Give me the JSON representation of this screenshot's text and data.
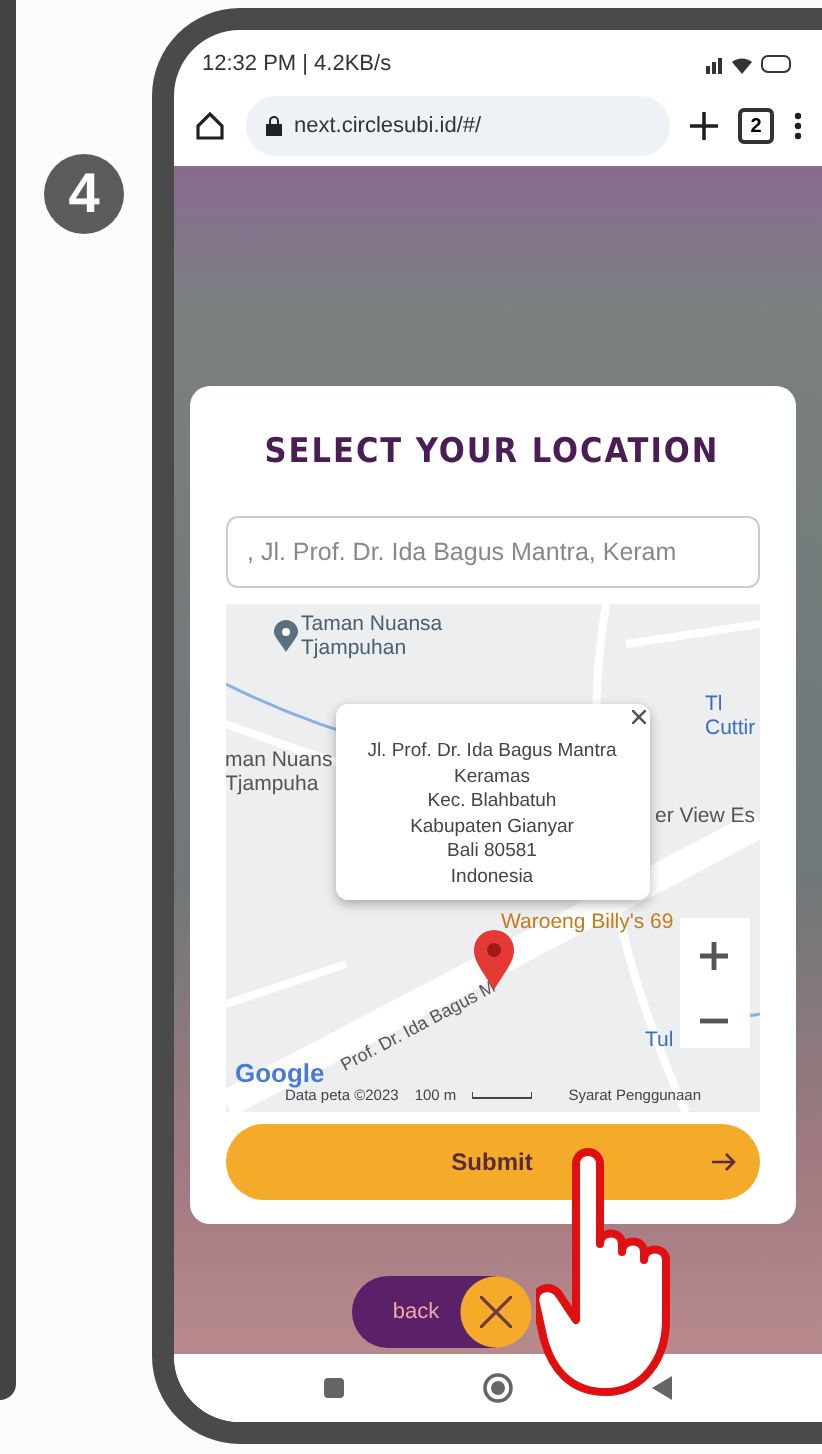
{
  "step_badge": "4",
  "status_bar": {
    "time": "12:32 PM | 4.2KB/s"
  },
  "browser": {
    "url": "next.circlesubi.id/#/",
    "tab_count": "2"
  },
  "modal": {
    "title": "SELECT YOUR LOCATION",
    "address_field": {
      "value": ", Jl. Prof. Dr. Ida Bagus Mantra, Keram"
    },
    "map": {
      "labels": [
        {
          "text": "Taman Nuansa\nTjampuhan",
          "kind": "place"
        },
        {
          "text": "Tl\nCuttir",
          "kind": "blue"
        },
        {
          "text": "man Nuans\nTjampuha",
          "kind": "plain"
        },
        {
          "text": "er View Es",
          "kind": "plain"
        },
        {
          "text": "Waroeng Billy's 69",
          "kind": "food"
        },
        {
          "text": "Prof. Dr. Ida Bagus M",
          "kind": "road"
        },
        {
          "text": "Tul",
          "kind": "blue"
        }
      ],
      "info_window": {
        "lines": [
          "Jl. Prof. Dr. Ida Bagus Mantra",
          "Keramas",
          "Kec. Blahbatuh",
          "Kabupaten Gianyar",
          "Bali 80581",
          "Indonesia"
        ]
      },
      "logo": "Google",
      "attribution": {
        "data": "Data peta ©2023",
        "scale": "100 m",
        "terms": "Syarat Penggunaan"
      }
    },
    "submit_button": "Submit"
  },
  "back_button": "back"
}
